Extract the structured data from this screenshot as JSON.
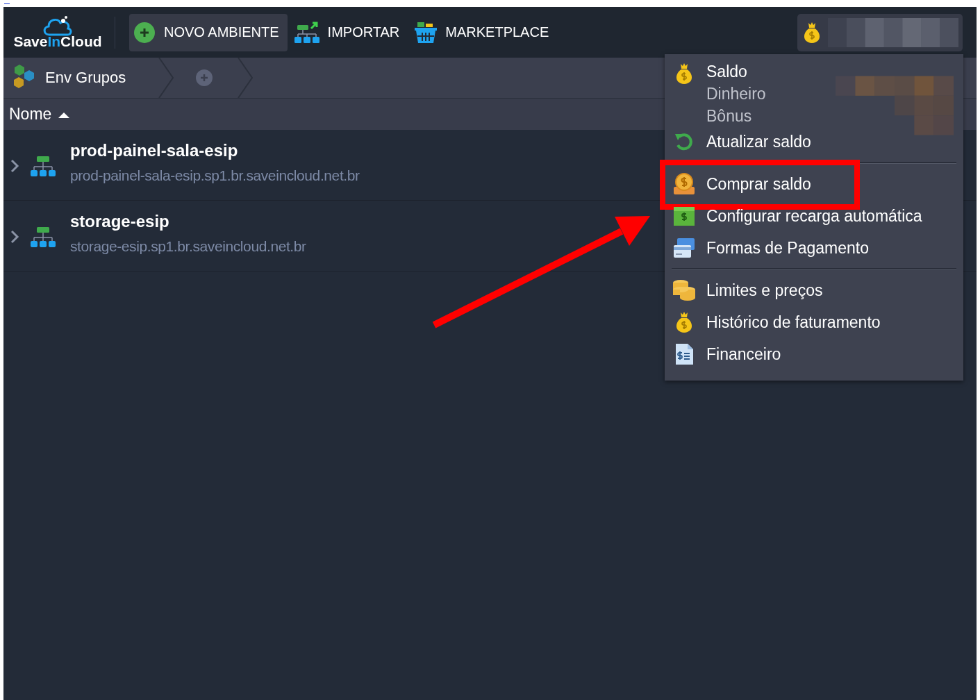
{
  "logo": {
    "parts": [
      "Save",
      "In",
      "Cloud"
    ]
  },
  "toolbar": [
    {
      "label": "NOVO AMBIENTE",
      "selected": true
    },
    {
      "label": "IMPORTAR",
      "selected": false
    },
    {
      "label": "MARKETPLACE",
      "selected": false
    }
  ],
  "breadcrumb": {
    "label": "Env Grupos"
  },
  "table": {
    "columns": [
      {
        "label": "Nome",
        "sorted_ascending": true
      }
    ],
    "rows": [
      {
        "name": "prod-painel-sala-esip",
        "url": "prod-painel-sala-esip.sp1.br.saveincloud.net.br",
        "expanded": false
      },
      {
        "name": "storage-esip",
        "url": "storage-esip.sp1.br.saveincloud.net.br",
        "expanded": false
      }
    ]
  },
  "balance_menu": {
    "items": [
      {
        "kind": "balance",
        "label": "Saldo",
        "lines": [
          "Dinheiro",
          "Bônus"
        ]
      },
      {
        "kind": "item",
        "label": "Atualizar saldo",
        "annotated": false
      },
      {
        "kind": "separator"
      },
      {
        "kind": "item",
        "label": "Comprar saldo",
        "annotated": true
      },
      {
        "kind": "item",
        "label": "Configurar recarga automática",
        "annotated": false
      },
      {
        "kind": "item",
        "label": "Formas de Pagamento",
        "annotated": false
      },
      {
        "kind": "separator"
      },
      {
        "kind": "item",
        "label": "Limites e preços",
        "annotated": false
      },
      {
        "kind": "item",
        "label": "Histórico de faturamento",
        "annotated": false
      },
      {
        "kind": "item",
        "label": "Financeiro",
        "annotated": false
      }
    ]
  }
}
